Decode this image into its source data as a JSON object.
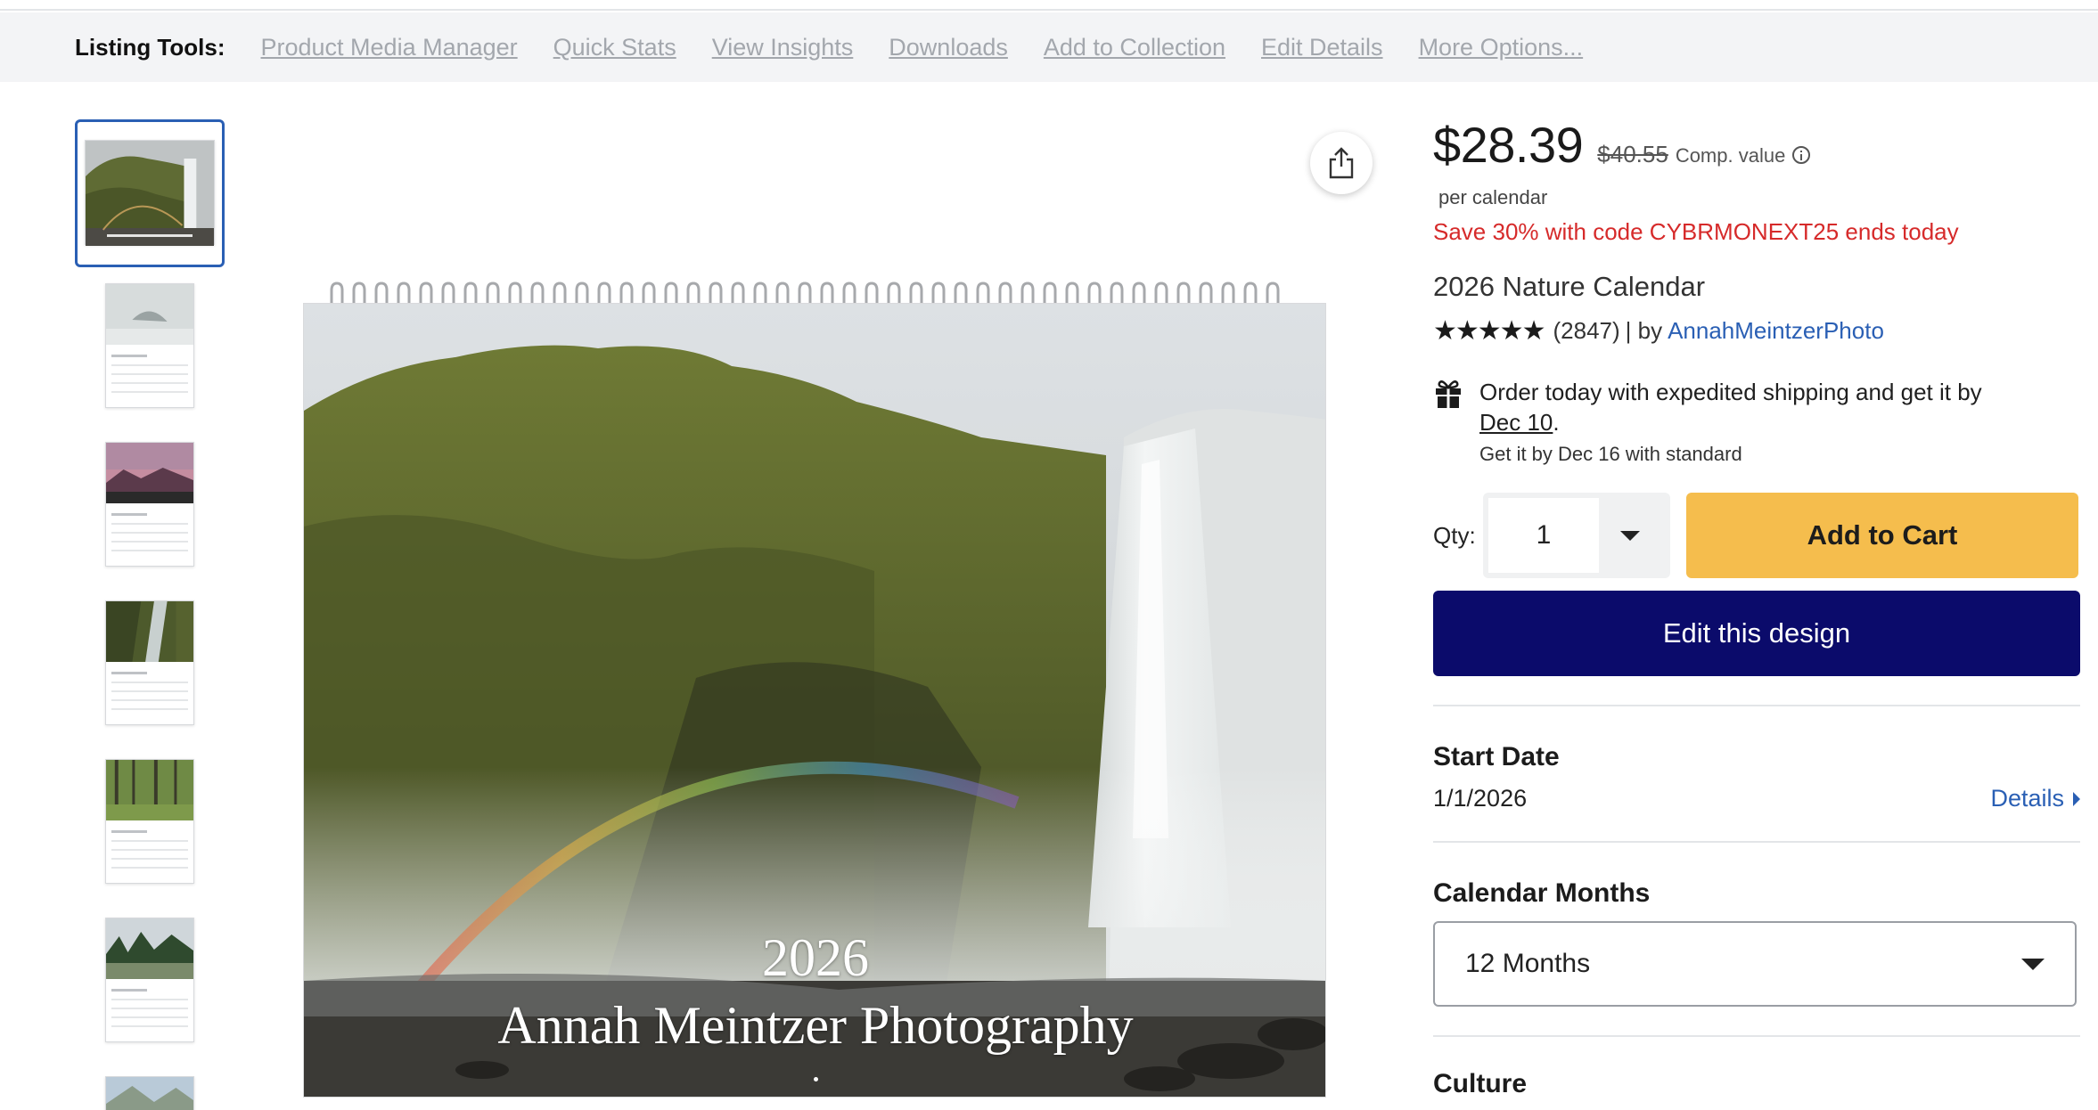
{
  "toolbar": {
    "title": "Listing Tools:",
    "links": [
      "Product Media Manager",
      "Quick Stats",
      "View Insights",
      "Downloads",
      "Add to Collection",
      "Edit Details",
      "More Options..."
    ]
  },
  "gallery": {
    "selected_index": 0,
    "thumbnails": [
      "cover-waterfall",
      "january-snow",
      "pink-mountains",
      "river-waterfall",
      "forest",
      "mountain-lake",
      "mountain-valley"
    ],
    "share_icon": "share-icon"
  },
  "calendar": {
    "year": "2026",
    "brand": "Annah Meintzer Photography"
  },
  "product": {
    "price": "$28.39",
    "old_price": "$40.55",
    "comp_label": "Comp. value",
    "per_unit": "per calendar",
    "promo": "Save 30% with code CYBRMONEXT25 ends today",
    "title": "2026 Nature Calendar",
    "stars": "★★★★★",
    "rating": 5,
    "review_count": "(2847)",
    "by_label": "| by",
    "author": "AnnahMeintzerPhoto"
  },
  "shipping": {
    "text": "Order today with expedited shipping and get it by",
    "date": "Dec 10",
    "date_suffix": ".",
    "standard": "Get it by Dec 16 with standard"
  },
  "buy": {
    "qty_label": "Qty:",
    "qty_value": "1",
    "add_to_cart": "Add to Cart",
    "edit_design": "Edit this design"
  },
  "options": {
    "start_date_title": "Start Date",
    "start_date_value": "1/1/2026",
    "details_link": "Details",
    "months_title": "Calendar Months",
    "months_value": "12 Months",
    "culture_title": "Culture"
  },
  "colors": {
    "accent_link": "#2a5fb4",
    "promo_red": "#d62a2a",
    "add_to_cart_bg": "#f5bd4d",
    "edit_design_bg": "#0b0b6b"
  }
}
